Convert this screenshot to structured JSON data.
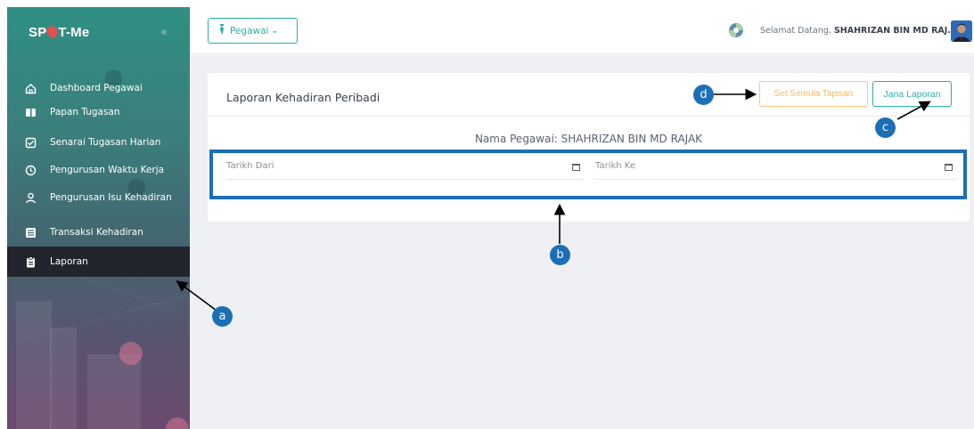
{
  "app": {
    "logo_text_left": "SP",
    "logo_text_right": "T-Me",
    "collapse_icon": "double-chevron-left-icon"
  },
  "sidebar": {
    "items": [
      {
        "label": "Dashboard Pegawai",
        "icon": "home-icon",
        "active": false
      },
      {
        "label": "Papan Tugasan",
        "icon": "board-icon",
        "active": false
      },
      {
        "label": "Senarai Tugasan Harian",
        "icon": "checklist-icon",
        "active": false
      },
      {
        "label": "Pengurusan Waktu Kerja",
        "icon": "clock-history-icon",
        "active": false
      },
      {
        "label": "Pengurusan Isu Kehadiran",
        "icon": "person-icon",
        "active": false
      },
      {
        "label": "Transaksi Kehadiran",
        "icon": "list-icon",
        "active": false
      },
      {
        "label": "Laporan",
        "icon": "clipboard-icon",
        "active": true
      }
    ]
  },
  "topbar": {
    "role_dropdown": "Pegawai",
    "welcome_prefix": "Selamat Datang,",
    "user_name": "SHAHRIZAN BIN MD RAJ..."
  },
  "card": {
    "title": "Laporan Kehadiran Peribadi",
    "reset_button": "Set Semula Tapisan",
    "generate_button": "Jana Laporan",
    "employee_name": "Nama Pegawai: SHAHRIZAN BIN MD RAJAK",
    "date_from_placeholder": "Tarikh Dari",
    "date_to_placeholder": "Tarikh Ke"
  },
  "callouts": {
    "a": "a",
    "b": "b",
    "c": "c",
    "d": "d"
  },
  "colors": {
    "accent": "#2bb0a3",
    "warning": "#f3b85c",
    "annotation": "#1c6fb5",
    "sidebar_active": "#22252b"
  }
}
